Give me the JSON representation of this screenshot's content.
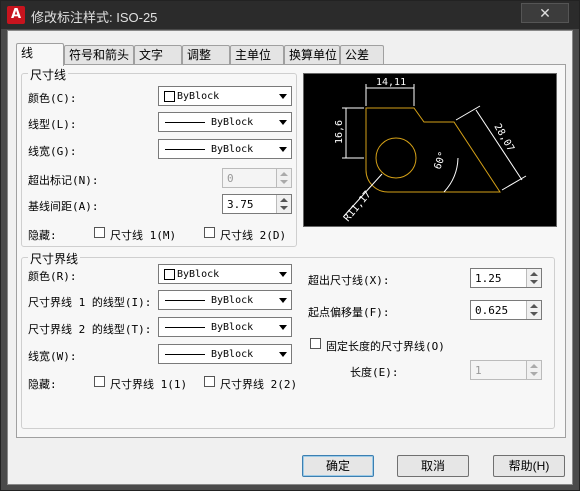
{
  "title": "修改标注样式: ISO-25",
  "tabs": [
    {
      "label": "线",
      "active": true
    },
    {
      "label": "符号和箭头"
    },
    {
      "label": "文字"
    },
    {
      "label": "调整"
    },
    {
      "label": "主单位"
    },
    {
      "label": "换算单位"
    },
    {
      "label": "公差"
    }
  ],
  "dimline": {
    "title": "尺寸线",
    "color_label": "颜色(C):",
    "color_value": "ByBlock",
    "linetype_label": "线型(L):",
    "linetype_value": "ByBlock",
    "lineweight_label": "线宽(G):",
    "lineweight_value": "ByBlock",
    "extend_label": "超出标记(N):",
    "extend_value": "0",
    "baseline_label": "基线间距(A):",
    "baseline_value": "3.75",
    "suppress_label": "隐藏:",
    "suppress1_label": "尺寸线 1(M)",
    "suppress2_label": "尺寸线 2(D)"
  },
  "extline": {
    "title": "尺寸界线",
    "color_label": "颜色(R):",
    "color_value": "ByBlock",
    "lt1_label": "尺寸界线 1 的线型(I):",
    "lt1_value": "ByBlock",
    "lt2_label": "尺寸界线 2 的线型(T):",
    "lt2_value": "ByBlock",
    "lineweight_label": "线宽(W):",
    "lineweight_value": "ByBlock",
    "suppress_label": "隐藏:",
    "suppress1_label": "尺寸界线 1(1)",
    "suppress2_label": "尺寸界线 2(2)",
    "beyond_label": "超出尺寸线(X):",
    "beyond_value": "1.25",
    "offset_label": "起点偏移量(F):",
    "offset_value": "0.625",
    "fixed_label": "固定长度的尺寸界线(O)",
    "length_label": "长度(E):",
    "length_value": "1"
  },
  "preview": {
    "dim_top": "14,11",
    "dim_left": "16,6",
    "dim_diag": "28,07",
    "dim_radius": "R11,17",
    "dim_angle": "60°"
  },
  "buttons": {
    "ok": "确定",
    "cancel": "取消",
    "help": "帮助(H)"
  },
  "colors": {
    "preview_bg": "#000000",
    "preview_geometry": "#d4a017",
    "preview_dims": "#ffffff"
  }
}
